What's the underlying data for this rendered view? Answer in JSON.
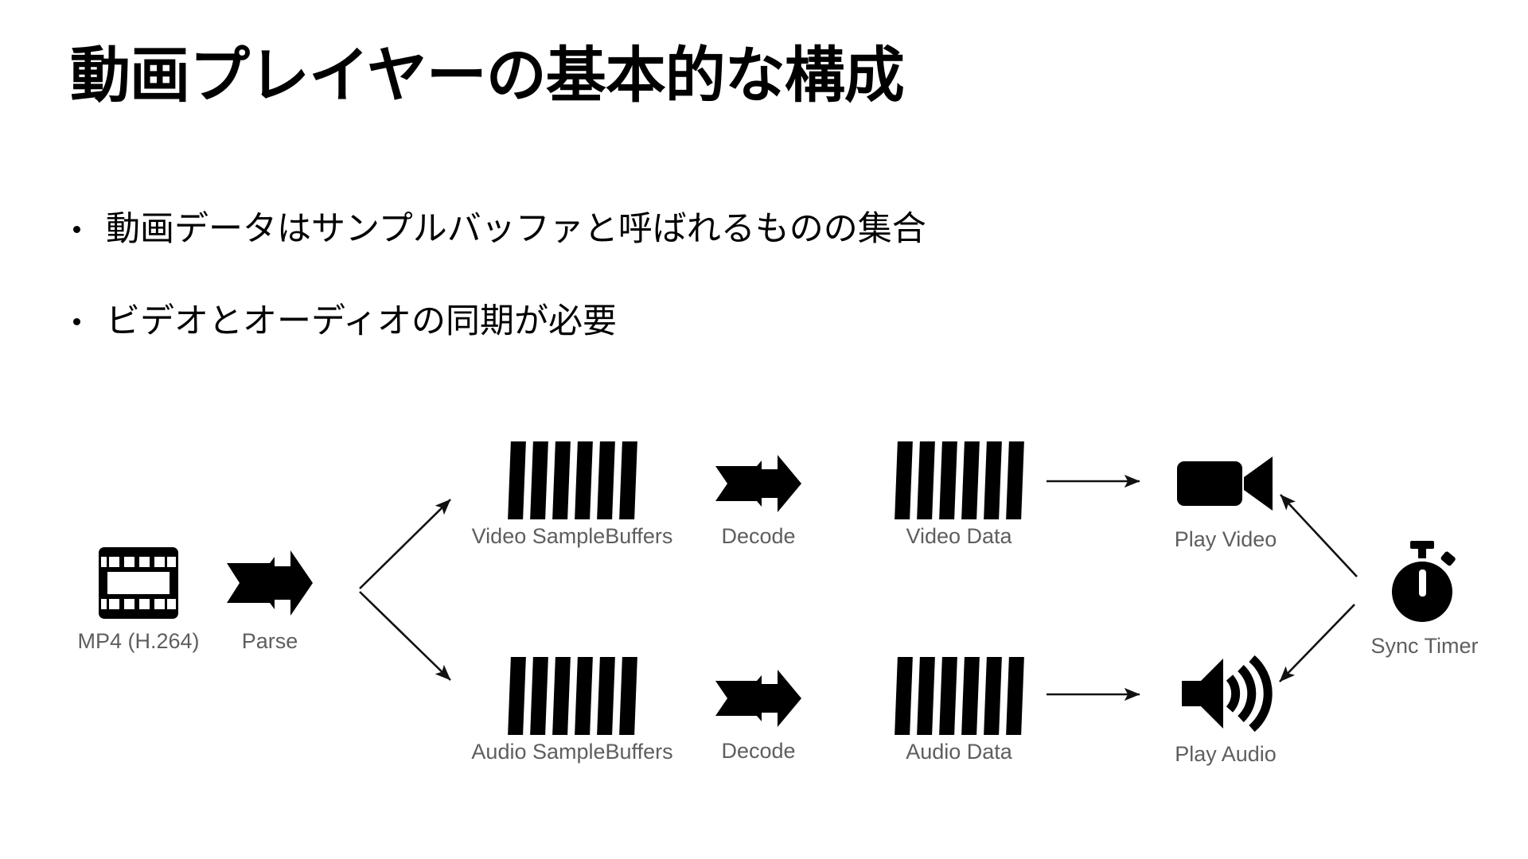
{
  "slide": {
    "title": "動画プレイヤーの基本的な構成",
    "background_color": "#ffffff",
    "text_color": "#000000",
    "label_color": "#5e5e5e"
  },
  "bullets": [
    {
      "text": "動画データはサンプルバッファと呼ばれるものの集合"
    },
    {
      "text": "ビデオとオーディオの同期が必要"
    }
  ],
  "diagram": {
    "nodes": [
      {
        "id": "source",
        "label": "MP4 (H.264)",
        "icon": "film-frame-icon"
      },
      {
        "id": "parse",
        "label": "Parse",
        "icon": "double-arrow-icon"
      },
      {
        "id": "video-buffers",
        "label": "Video SampleBuffers",
        "icon": "sample-buffer-bars-icon"
      },
      {
        "id": "video-decode",
        "label": "Decode",
        "icon": "double-arrow-icon"
      },
      {
        "id": "video-data",
        "label": "Video Data",
        "icon": "sample-buffer-bars-icon"
      },
      {
        "id": "play-video",
        "label": "Play Video",
        "icon": "video-camera-icon"
      },
      {
        "id": "audio-buffers",
        "label": "Audio SampleBuffers",
        "icon": "sample-buffer-bars-icon"
      },
      {
        "id": "audio-decode",
        "label": "Decode",
        "icon": "double-arrow-icon"
      },
      {
        "id": "audio-data",
        "label": "Audio Data",
        "icon": "sample-buffer-bars-icon"
      },
      {
        "id": "play-audio",
        "label": "Play Audio",
        "icon": "speaker-icon"
      },
      {
        "id": "sync-timer",
        "label": "Sync Timer",
        "icon": "stopwatch-icon"
      }
    ],
    "bar_count": 6,
    "connectors": [
      {
        "from": "parse",
        "to": "video-buffers",
        "style": "branch-up"
      },
      {
        "from": "parse",
        "to": "audio-buffers",
        "style": "branch-down"
      },
      {
        "from": "video-data",
        "to": "play-video",
        "style": "straight"
      },
      {
        "from": "audio-data",
        "to": "play-audio",
        "style": "straight"
      },
      {
        "from": "sync-timer",
        "to": "play-video",
        "style": "diagonal-up-left"
      },
      {
        "from": "sync-timer",
        "to": "play-audio",
        "style": "diagonal-down-left"
      }
    ]
  }
}
